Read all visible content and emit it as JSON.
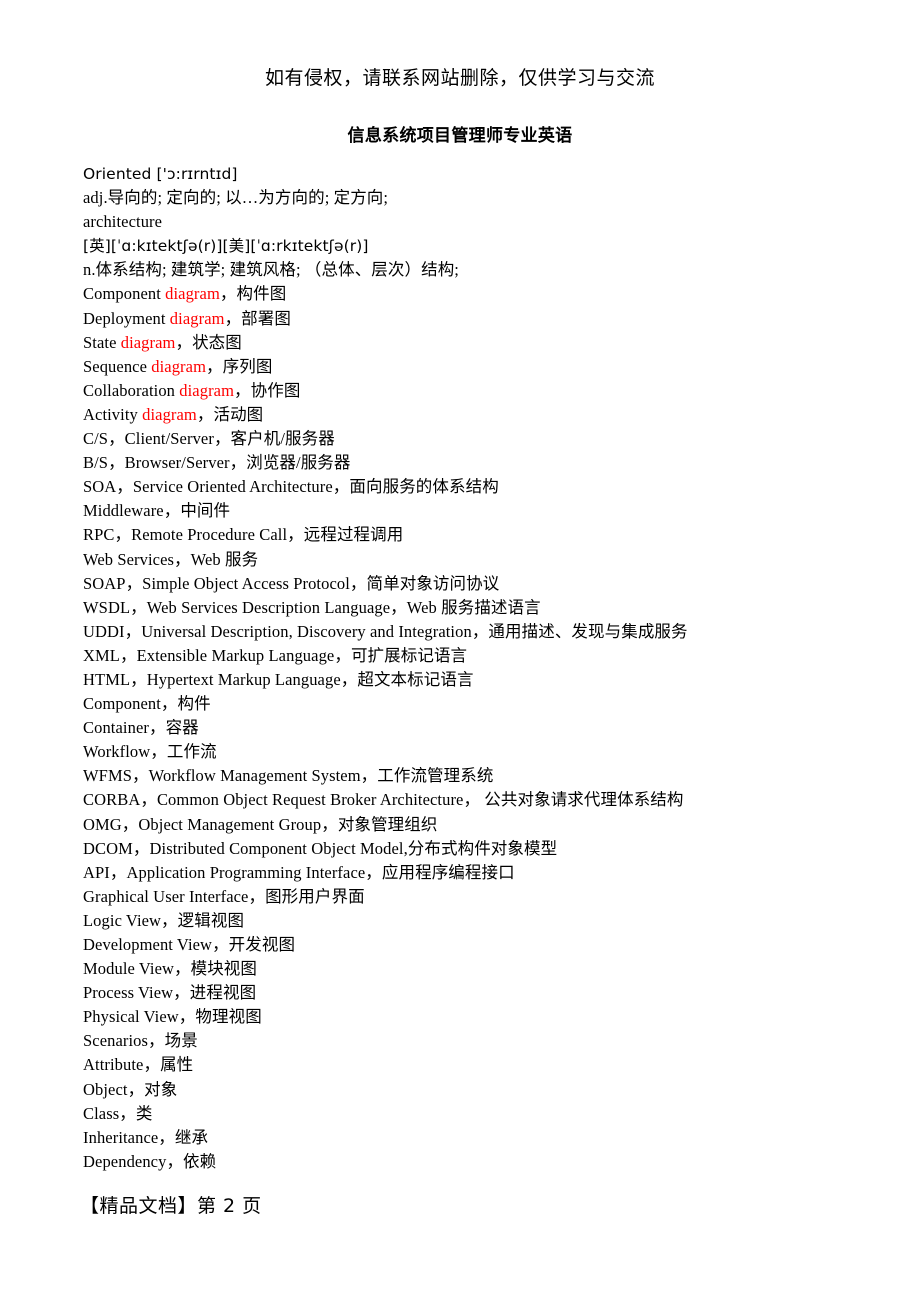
{
  "notice": "如有侵权，请联系网站删除，仅供学习与交流",
  "title": "信息系统项目管理师专业英语",
  "accent_color": "#ff0000",
  "text_color": "#000000",
  "background_color": "#ffffff",
  "footer": "【精品文档】第 2 页",
  "lines": [
    {
      "id": "oriented-headword",
      "text": "Oriented ['ɔ:rɪrntɪd]",
      "style": "ipa",
      "highlight": null
    },
    {
      "id": "oriented-definition",
      "text": "adj.导向的; 定向的; 以…为方向的; 定方向;",
      "style": "normal",
      "highlight": null
    },
    {
      "id": "architecture-headword",
      "text": "architecture",
      "style": "normal",
      "highlight": null
    },
    {
      "id": "architecture-ipa",
      "text": "[英][ˈɑ:kɪtektʃə(r)][美][ˈɑ:rkɪtektʃə(r)]",
      "style": "ipa",
      "highlight": null
    },
    {
      "id": "architecture-definition",
      "text": "n.体系结构; 建筑学; 建筑风格; （总体、层次）结构;",
      "style": "normal",
      "highlight": null
    },
    {
      "id": "component-diagram",
      "text": "Component diagram，构件图",
      "style": "normal",
      "highlight": "diagram"
    },
    {
      "id": "deployment-diagram",
      "text": "Deployment diagram，部署图",
      "style": "normal",
      "highlight": "diagram"
    },
    {
      "id": "state-diagram",
      "text": "State diagram，状态图",
      "style": "normal",
      "highlight": "diagram"
    },
    {
      "id": "sequence-diagram",
      "text": "Sequence diagram，序列图",
      "style": "normal",
      "highlight": "diagram"
    },
    {
      "id": "collaboration-diagram",
      "text": "Collaboration diagram，协作图",
      "style": "normal",
      "highlight": "diagram"
    },
    {
      "id": "activity-diagram",
      "text": "Activity diagram，活动图",
      "style": "normal",
      "highlight": "diagram"
    },
    {
      "id": "cs",
      "text": "C/S，Client/Server，客户机/服务器",
      "style": "normal",
      "highlight": null
    },
    {
      "id": "bs",
      "text": "B/S，Browser/Server，浏览器/服务器",
      "style": "normal",
      "highlight": null
    },
    {
      "id": "soa",
      "text": "SOA，Service Oriented Architecture，面向服务的体系结构",
      "style": "normal",
      "highlight": null
    },
    {
      "id": "middleware",
      "text": "Middleware，中间件",
      "style": "normal",
      "highlight": null
    },
    {
      "id": "rpc",
      "text": "RPC，Remote Procedure Call，远程过程调用",
      "style": "normal",
      "highlight": null
    },
    {
      "id": "web-services",
      "text": "Web Services，Web 服务",
      "style": "normal",
      "highlight": null
    },
    {
      "id": "soap",
      "text": "SOAP，Simple Object Access Protocol，简单对象访问协议",
      "style": "normal",
      "highlight": null
    },
    {
      "id": "wsdl",
      "text": "WSDL，Web Services Description Language，Web 服务描述语言",
      "style": "normal",
      "highlight": null
    },
    {
      "id": "uddi",
      "text": "UDDI，Universal Description, Discovery and Integration，通用描述、发现与集成服务",
      "style": "normal",
      "highlight": null
    },
    {
      "id": "xml",
      "text": "XML，Extensible Markup Language，可扩展标记语言",
      "style": "normal",
      "highlight": null
    },
    {
      "id": "html",
      "text": "HTML，Hypertext Markup Language，超文本标记语言",
      "style": "normal",
      "highlight": null
    },
    {
      "id": "component",
      "text": "Component，构件",
      "style": "normal",
      "highlight": null
    },
    {
      "id": "container",
      "text": "Container，容器",
      "style": "normal",
      "highlight": null
    },
    {
      "id": "workflow",
      "text": "Workflow，工作流",
      "style": "normal",
      "highlight": null
    },
    {
      "id": "wfms",
      "text": "WFMS，Workflow Management System，工作流管理系统",
      "style": "normal",
      "highlight": null
    },
    {
      "id": "corba",
      "text": "CORBA，Common Object Request Broker Architecture， 公共对象请求代理体系结构",
      "style": "normal",
      "highlight": null
    },
    {
      "id": "omg",
      "text": "OMG，Object Management Group，对象管理组织",
      "style": "normal",
      "highlight": null
    },
    {
      "id": "dcom",
      "text": "DCOM，Distributed Component Object Model,分布式构件对象模型",
      "style": "normal",
      "highlight": null
    },
    {
      "id": "api",
      "text": "API，Application Programming Interface，应用程序编程接口",
      "style": "normal",
      "highlight": null
    },
    {
      "id": "gui",
      "text": "Graphical User Interface，图形用户界面",
      "style": "normal",
      "highlight": null
    },
    {
      "id": "logic-view",
      "text": "Logic View，逻辑视图",
      "style": "normal",
      "highlight": null
    },
    {
      "id": "development-view",
      "text": "Development View，开发视图",
      "style": "normal",
      "highlight": null
    },
    {
      "id": "module-view",
      "text": "Module View，模块视图",
      "style": "normal",
      "highlight": null
    },
    {
      "id": "process-view",
      "text": "Process View，进程视图",
      "style": "normal",
      "highlight": null
    },
    {
      "id": "physical-view",
      "text": "Physical View，物理视图",
      "style": "normal",
      "highlight": null
    },
    {
      "id": "scenarios",
      "text": "Scenarios，场景",
      "style": "normal",
      "highlight": null
    },
    {
      "id": "attribute",
      "text": "Attribute，属性",
      "style": "normal",
      "highlight": null
    },
    {
      "id": "object",
      "text": "Object，对象",
      "style": "normal",
      "highlight": null
    },
    {
      "id": "class",
      "text": "Class，类",
      "style": "normal",
      "highlight": null
    },
    {
      "id": "inheritance",
      "text": "Inheritance，继承",
      "style": "normal",
      "highlight": null
    },
    {
      "id": "dependency",
      "text": "Dependency，依赖",
      "style": "normal",
      "highlight": null
    }
  ]
}
